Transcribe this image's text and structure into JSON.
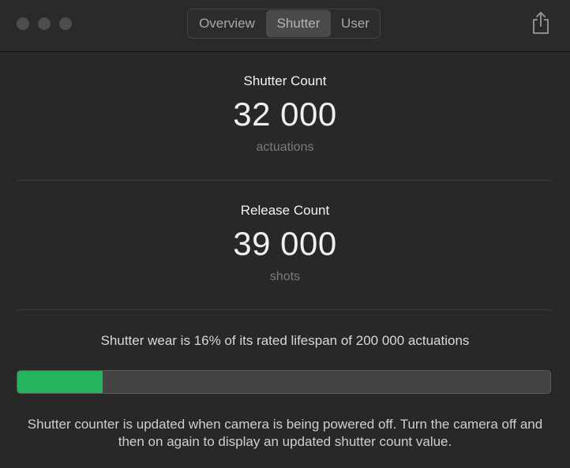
{
  "tabs": [
    {
      "label": "Overview",
      "selected": false
    },
    {
      "label": "Shutter",
      "selected": true
    },
    {
      "label": "User",
      "selected": false
    }
  ],
  "toolbar": {
    "share_icon": "share-icon"
  },
  "shutter_count": {
    "label": "Shutter Count",
    "value": "32 000",
    "unit": "actuations"
  },
  "release_count": {
    "label": "Release Count",
    "value": "39 000",
    "unit": "shots"
  },
  "wear": {
    "text": "Shutter wear is 16% of its rated lifespan of 200 000 actuations",
    "fraction": 0.16,
    "color": "#27b35e"
  },
  "note": {
    "text": "Shutter counter is updated when camera is being powered off. Turn the camera off and then on again to display an updated shutter count value."
  }
}
